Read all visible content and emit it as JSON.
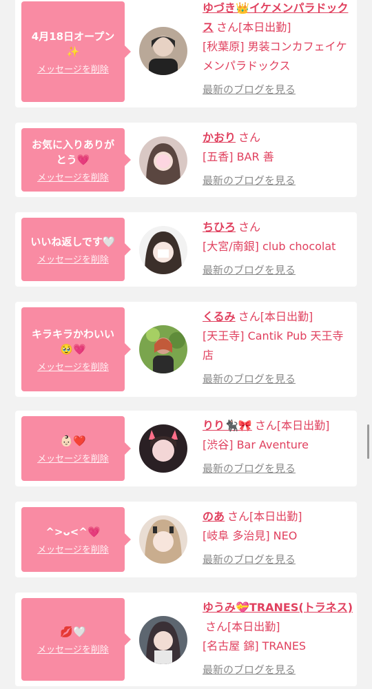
{
  "colors": {
    "accent": "#f98ba3",
    "text_pink": "#e0405e",
    "blog_gray": "#8a8a8a",
    "bg": "#f2f2f2"
  },
  "delete_label": "メッセージを削除",
  "san_label": "さん",
  "blog_label": "最新のブログを見る",
  "entries": [
    {
      "message": "4月18日オープン✨",
      "name": "ゆづき👑イケメンパラドックス",
      "shift": "[本日出勤]",
      "shop": "[秋葉原] 男装コンカフェイケメンパラドックス"
    },
    {
      "message": "お気に入りありがとう💗",
      "name": "かおり",
      "shift": "",
      "shop": "[五香] BAR 善"
    },
    {
      "message": "いいね返しです🤍",
      "name": "ちひろ",
      "shift": "",
      "shop": "[大宮/南銀] club chocolat"
    },
    {
      "message": "キラキラかわいい🥹💗",
      "name": "くるみ",
      "shift": "[本日出勤]",
      "shop": "[天王寺] Cantik Pub 天王寺店"
    },
    {
      "message": "👶🏻❤️",
      "name": "りり🐈‍⬛🎀",
      "shift": "[本日出勤]",
      "shop": "[渋谷] Bar Aventure"
    },
    {
      "message": "^>ᴗ<^💗",
      "name": "のあ",
      "shift": "[本日出勤]",
      "shop": "[岐阜 多治見] NEO"
    },
    {
      "message": "💋🤍",
      "name": "ゆうみ💝TRANES(トラネス)",
      "shift": "[本日出勤]",
      "shop": "[名古屋 錦] TRANES"
    }
  ]
}
